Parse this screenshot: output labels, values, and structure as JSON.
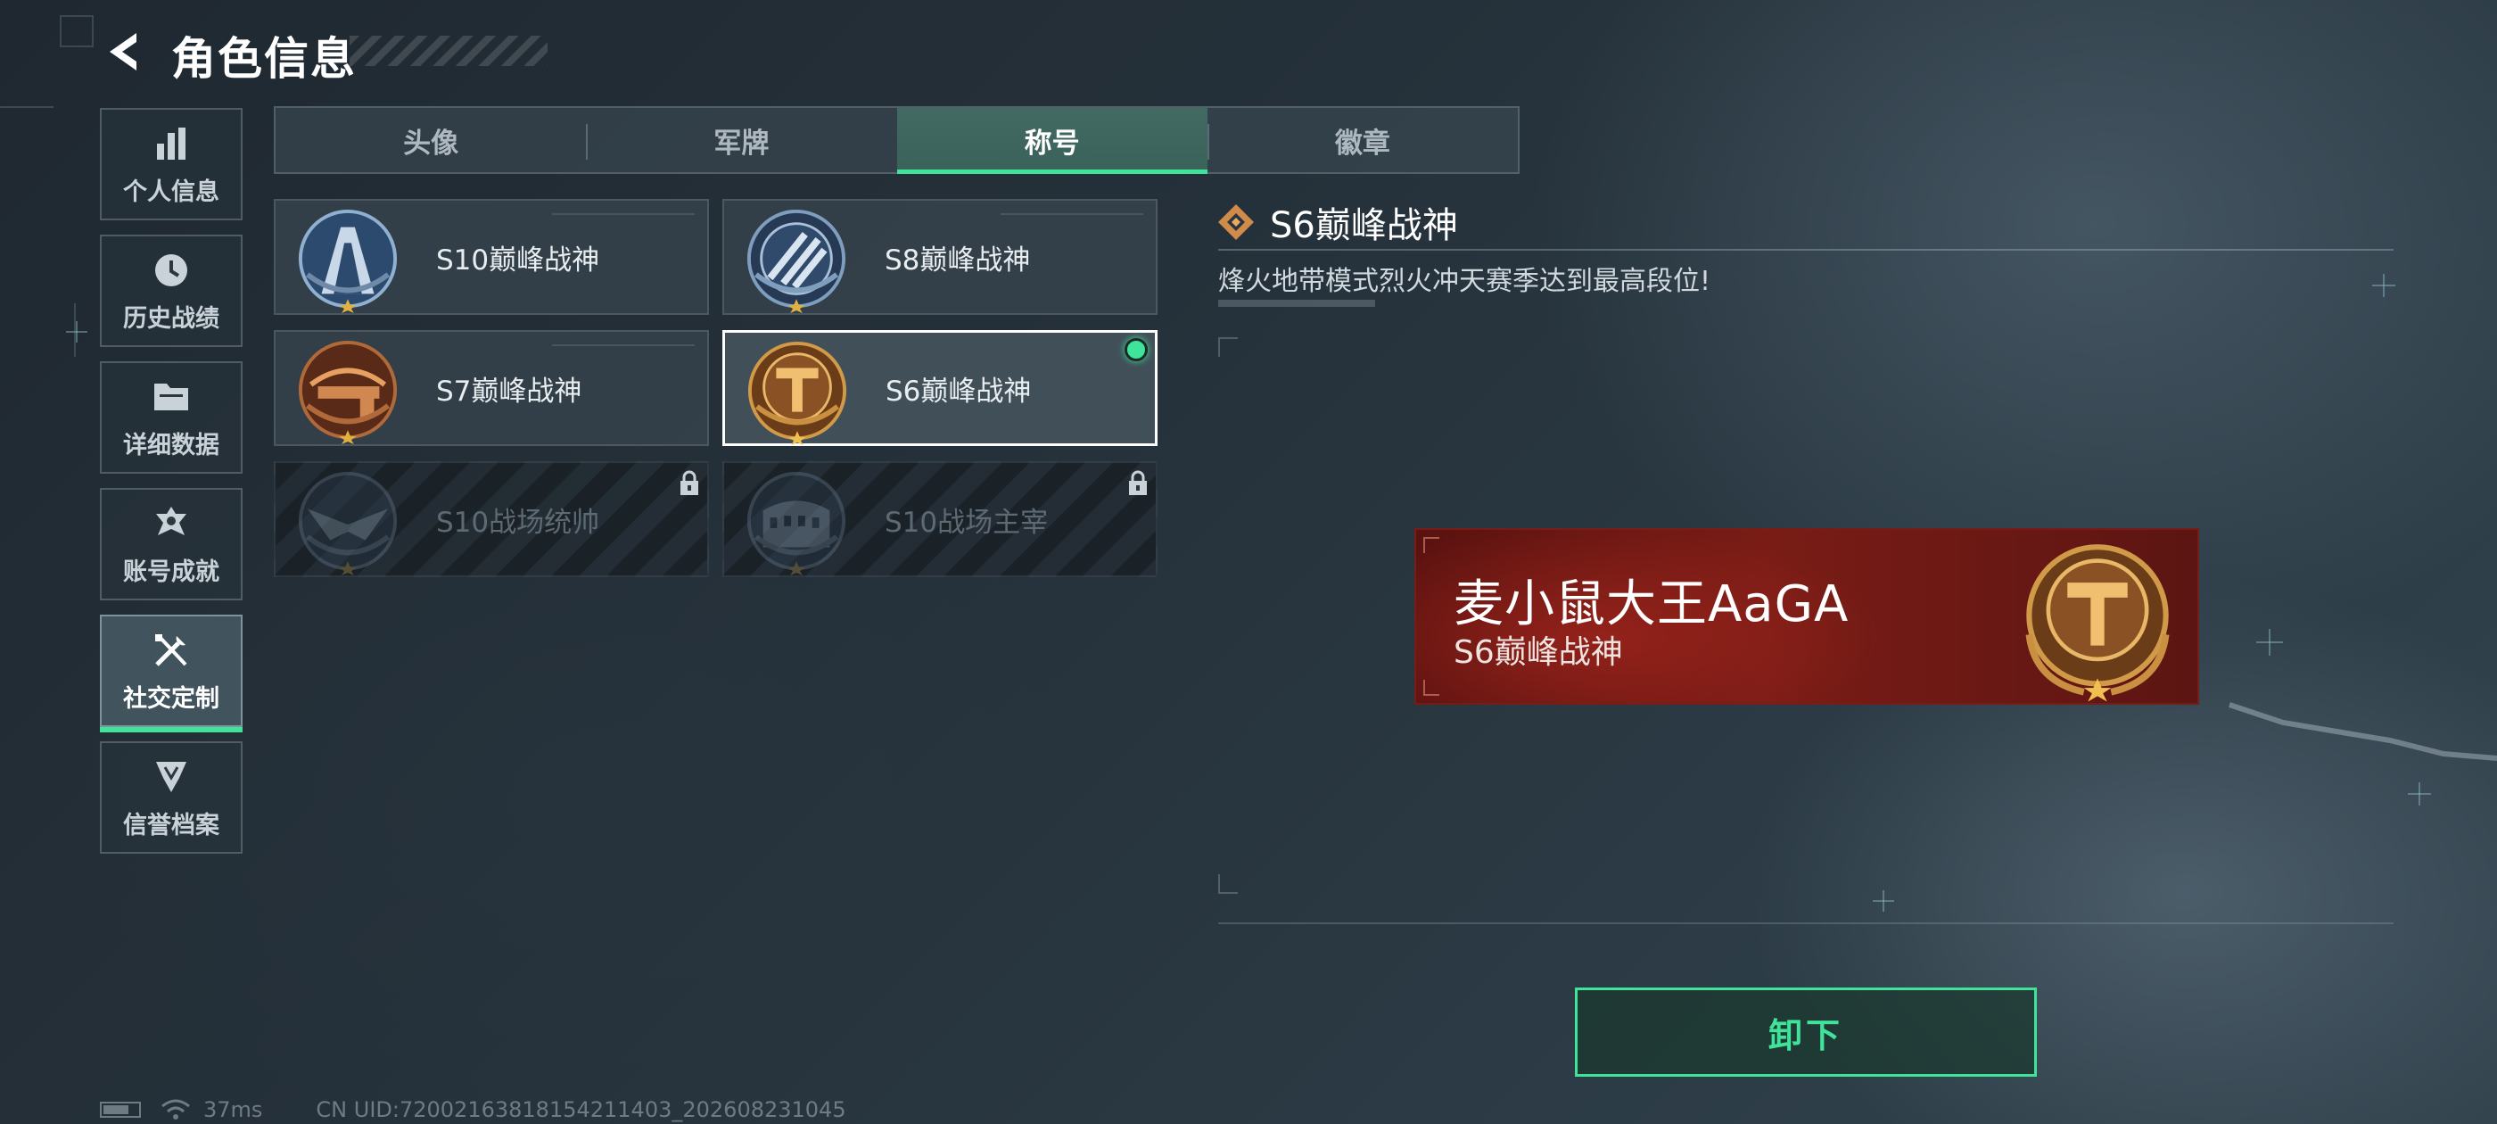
{
  "header": {
    "title": "角色信息"
  },
  "sidebar": {
    "items": [
      {
        "label": "个人信息",
        "icon": "bar-chart-icon"
      },
      {
        "label": "历史战绩",
        "icon": "clock-icon"
      },
      {
        "label": "详细数据",
        "icon": "folder-icon"
      },
      {
        "label": "账号成就",
        "icon": "achievement-icon"
      },
      {
        "label": "社交定制",
        "icon": "tools-icon",
        "active": true
      },
      {
        "label": "信誉档案",
        "icon": "shield-icon"
      }
    ]
  },
  "tabs": [
    {
      "label": "头像"
    },
    {
      "label": "军牌"
    },
    {
      "label": "称号",
      "active": true
    },
    {
      "label": "徽章"
    }
  ],
  "titles": [
    {
      "label": "S10巅峰战神",
      "emblem": "tower-emblem",
      "locked": false
    },
    {
      "label": "S8巅峰战神",
      "emblem": "slash-emblem",
      "locked": false
    },
    {
      "label": "S7巅峰战神",
      "emblem": "crossbow-emblem",
      "locked": false
    },
    {
      "label": "S6巅峰战神",
      "emblem": "t-emblem",
      "locked": false,
      "equipped": true,
      "selected": true
    },
    {
      "label": "S10战场统帅",
      "emblem": "eagle-emblem",
      "locked": true
    },
    {
      "label": "S10战场主宰",
      "emblem": "colosseum-emblem",
      "locked": true
    }
  ],
  "detail": {
    "title": "S6巅峰战神",
    "description": "烽火地带模式烈火冲天赛季达到最高段位!"
  },
  "preview": {
    "player_name": "麦小鼠大王AaGA",
    "title": "S6巅峰战神"
  },
  "actions": {
    "unequip_label": "卸下"
  },
  "status_bar": {
    "ping": "37ms",
    "uid": "CN UID:72002163818154211403_202608231045"
  },
  "colors": {
    "accent": "#3fe39a",
    "banner": "#6e1a14",
    "gold": "#c8963c"
  }
}
